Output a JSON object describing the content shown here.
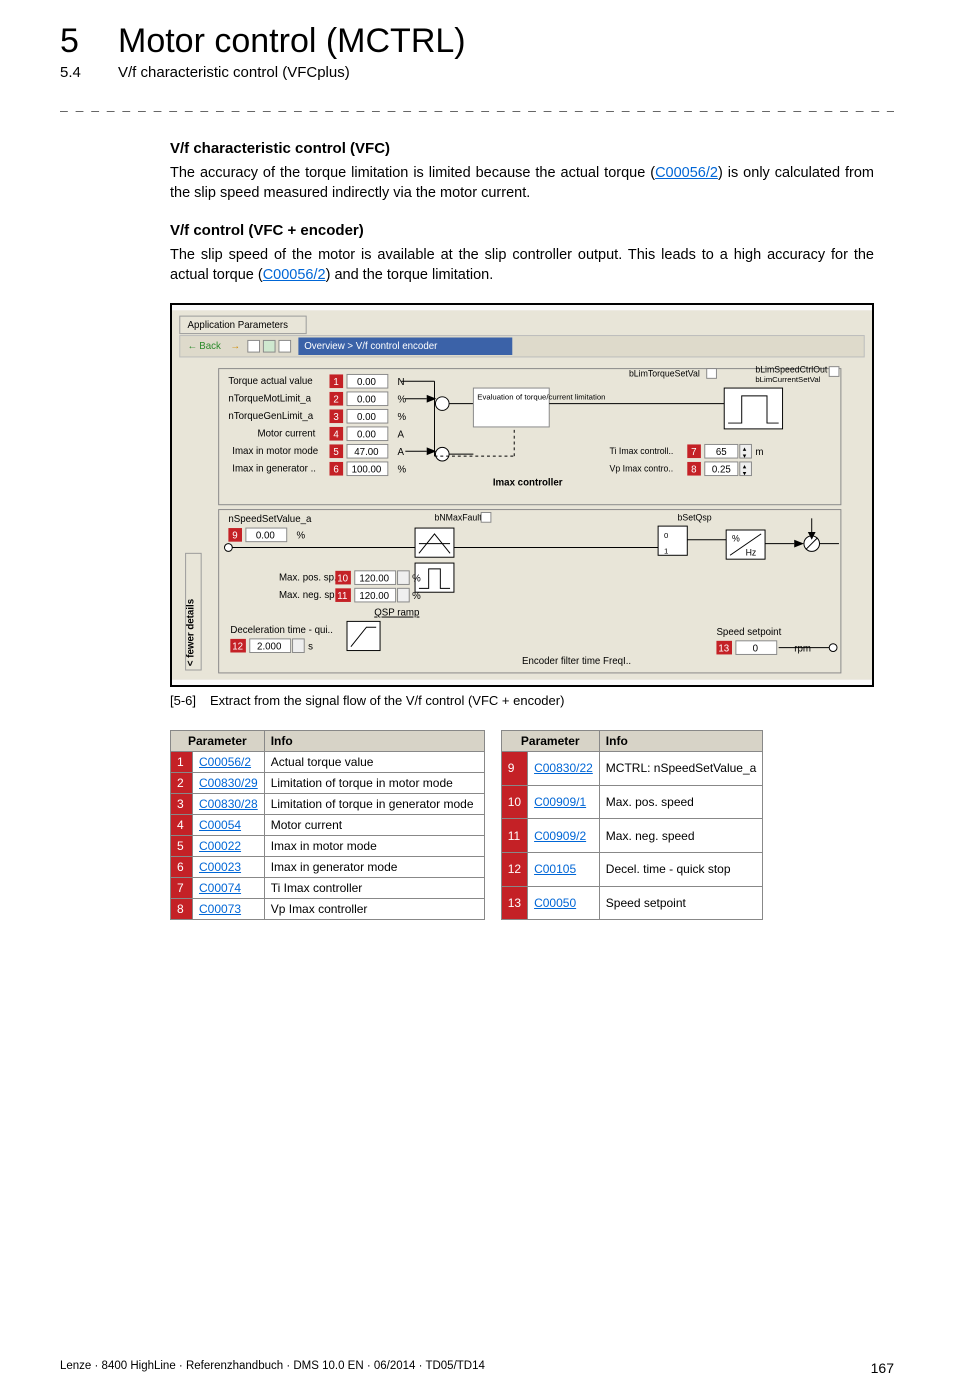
{
  "header": {
    "chapter_number": "5",
    "chapter_title": "Motor control (MCTRL)",
    "section_number": "5.4",
    "section_title": "V/f characteristic control (VFCplus)",
    "dashline": "_ _ _ _ _ _ _ _ _ _ _ _ _ _ _ _ _ _ _ _ _ _ _ _ _ _ _ _ _ _ _ _ _ _ _ _ _ _ _ _ _ _ _ _ _ _ _ _ _ _ _ _ _ _ _ _ _ _ _ _ _ _ _ _"
  },
  "section1": {
    "heading": "V/f characteristic control (VFC)",
    "pre": "The accuracy of the torque limitation is limited because the actual torque (",
    "link": "C00056/2",
    "post": ") is only calculated from the slip speed measured indirectly via the motor current."
  },
  "section2": {
    "heading": "V/f control (VFC + encoder)",
    "pre": "The slip speed of the motor is available at the slip controller output. This leads to a high accuracy for the actual torque (",
    "link": "C00056/2",
    "post": ") and the torque limitation."
  },
  "figure": {
    "tab_label": "Application Parameters",
    "back_label": "Back",
    "breadcrumb": "Overview > V/f control encoder",
    "labels": {
      "torque_actual": "Torque actual value",
      "ntorque_mot": "nTorqueMotLimit_a",
      "ntorque_gen": "nTorqueGenLimit_a",
      "motor_current": "Motor current",
      "imax_motor": "Imax in motor mode",
      "imax_gen": "Imax in generator ..",
      "nspeed": "nSpeedSetValue_a",
      "max_pos": "Max. pos. sp..",
      "max_neg": "Max. neg. sp..",
      "qsp": "QSP ramp",
      "decel": "Deceleration time - qui..",
      "eval": "Evaluation of torque/current limitation",
      "ti_imax": "Ti Imax controll..",
      "vp_imax": "Vp Imax contro..",
      "imax_ctrl": "Imax controller",
      "bnmax": "bNMaxFault",
      "bsetqsp": "bSetQsp",
      "blim_torque": "bLimTorqueSetVal",
      "blim_speed": "bLimSpeedCtrlOut",
      "blim_current": "bLimCurrentSetVal",
      "speed_set": "Speed setpoint",
      "enc_filter": "Encoder filter time FreqI..",
      "fewer": "< fewer details"
    },
    "values": {
      "v1": "0.00",
      "u1": "N",
      "v2": "0.00",
      "u2": "%",
      "v3": "0.00",
      "u3": "%",
      "v4": "0.00",
      "u4": "A",
      "v5": "47.00",
      "u5": "A",
      "v6": "100.00",
      "u6": "%",
      "v7": "65",
      "u7": "m",
      "v8": "0.25",
      "v9": "0.00",
      "u9": "%",
      "v10": "120.00",
      "u10": "%",
      "v11": "120.00",
      "u11": "%",
      "v12": "2.000",
      "u12": "s",
      "v13": "0",
      "u13": "rpm",
      "hz": "Hz",
      "pct": "%"
    },
    "markers": [
      "1",
      "2",
      "3",
      "4",
      "5",
      "6",
      "7",
      "8",
      "9",
      "10",
      "11",
      "12",
      "13"
    ]
  },
  "caption": {
    "num": "[5-6]",
    "text": "Extract from the signal flow of the V/f control (VFC + encoder)"
  },
  "tables": {
    "header_param": "Parameter",
    "header_info": "Info",
    "left": [
      {
        "n": "1",
        "code": "C00056/2",
        "info": "Actual torque value"
      },
      {
        "n": "2",
        "code": "C00830/29",
        "info": "Limitation of torque in motor mode"
      },
      {
        "n": "3",
        "code": "C00830/28",
        "info": "Limitation of torque in generator mode"
      },
      {
        "n": "4",
        "code": "C00054",
        "info": "Motor current"
      },
      {
        "n": "5",
        "code": "C00022",
        "info": "Imax in motor mode"
      },
      {
        "n": "6",
        "code": "C00023",
        "info": "Imax in generator mode"
      },
      {
        "n": "7",
        "code": "C00074",
        "info": "Ti Imax controller"
      },
      {
        "n": "8",
        "code": "C00073",
        "info": "Vp Imax controller"
      }
    ],
    "right": [
      {
        "n": "9",
        "code": "C00830/22",
        "info": "MCTRL: nSpeedSetValue_a"
      },
      {
        "n": "10",
        "code": "C00909/1",
        "info": "Max. pos. speed"
      },
      {
        "n": "11",
        "code": "C00909/2",
        "info": "Max. neg. speed"
      },
      {
        "n": "12",
        "code": "C00105",
        "info": "Decel. time - quick stop"
      },
      {
        "n": "13",
        "code": "C00050",
        "info": "Speed setpoint"
      }
    ]
  },
  "footer": {
    "left": "Lenze · 8400 HighLine · Referenzhandbuch · DMS 10.0 EN · 06/2014 · TD05/TD14",
    "page": "167"
  }
}
